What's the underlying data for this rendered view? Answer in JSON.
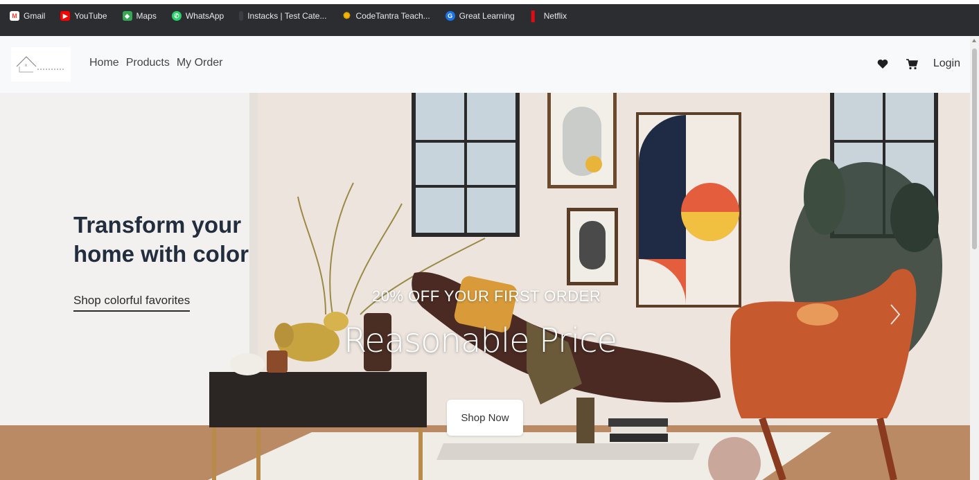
{
  "bookmarks": [
    {
      "label": "Gmail",
      "icon": "gmail-icon",
      "color": "#ea4335"
    },
    {
      "label": "YouTube",
      "icon": "youtube-icon",
      "color": "#ff0000"
    },
    {
      "label": "Maps",
      "icon": "maps-icon",
      "color": "#34a853"
    },
    {
      "label": "WhatsApp",
      "icon": "whatsapp-icon",
      "color": "#25d366"
    },
    {
      "label": "Instacks | Test Cate...",
      "icon": "instacks-icon",
      "color": "#3a3d42"
    },
    {
      "label": "CodeTantra Teach...",
      "icon": "codetantra-icon",
      "color": "#f4b400"
    },
    {
      "label": "Great Learning",
      "icon": "great-learning-icon",
      "color": "#1a73e8"
    },
    {
      "label": "Netflix",
      "icon": "netflix-icon",
      "color": "#e50914"
    }
  ],
  "header": {
    "nav": [
      "Home",
      "Products",
      "My Order"
    ],
    "login_label": "Login",
    "wishlist_icon": "heart-icon",
    "cart_icon": "cart-icon"
  },
  "hero": {
    "promo_title": "Transform your home with color",
    "promo_link": "Shop colorful favorites",
    "offer": "20% OFF YOUR FIRST ORDER",
    "headline": "Reasonable Price",
    "cta_label": "Shop Now",
    "next_icon": "chevron-right-icon"
  },
  "colors": {
    "bookmarks_bar": "#2b2d31",
    "header_bg": "#f8f9fb",
    "title_color": "#222d3d",
    "chair": "#c65a2e"
  }
}
